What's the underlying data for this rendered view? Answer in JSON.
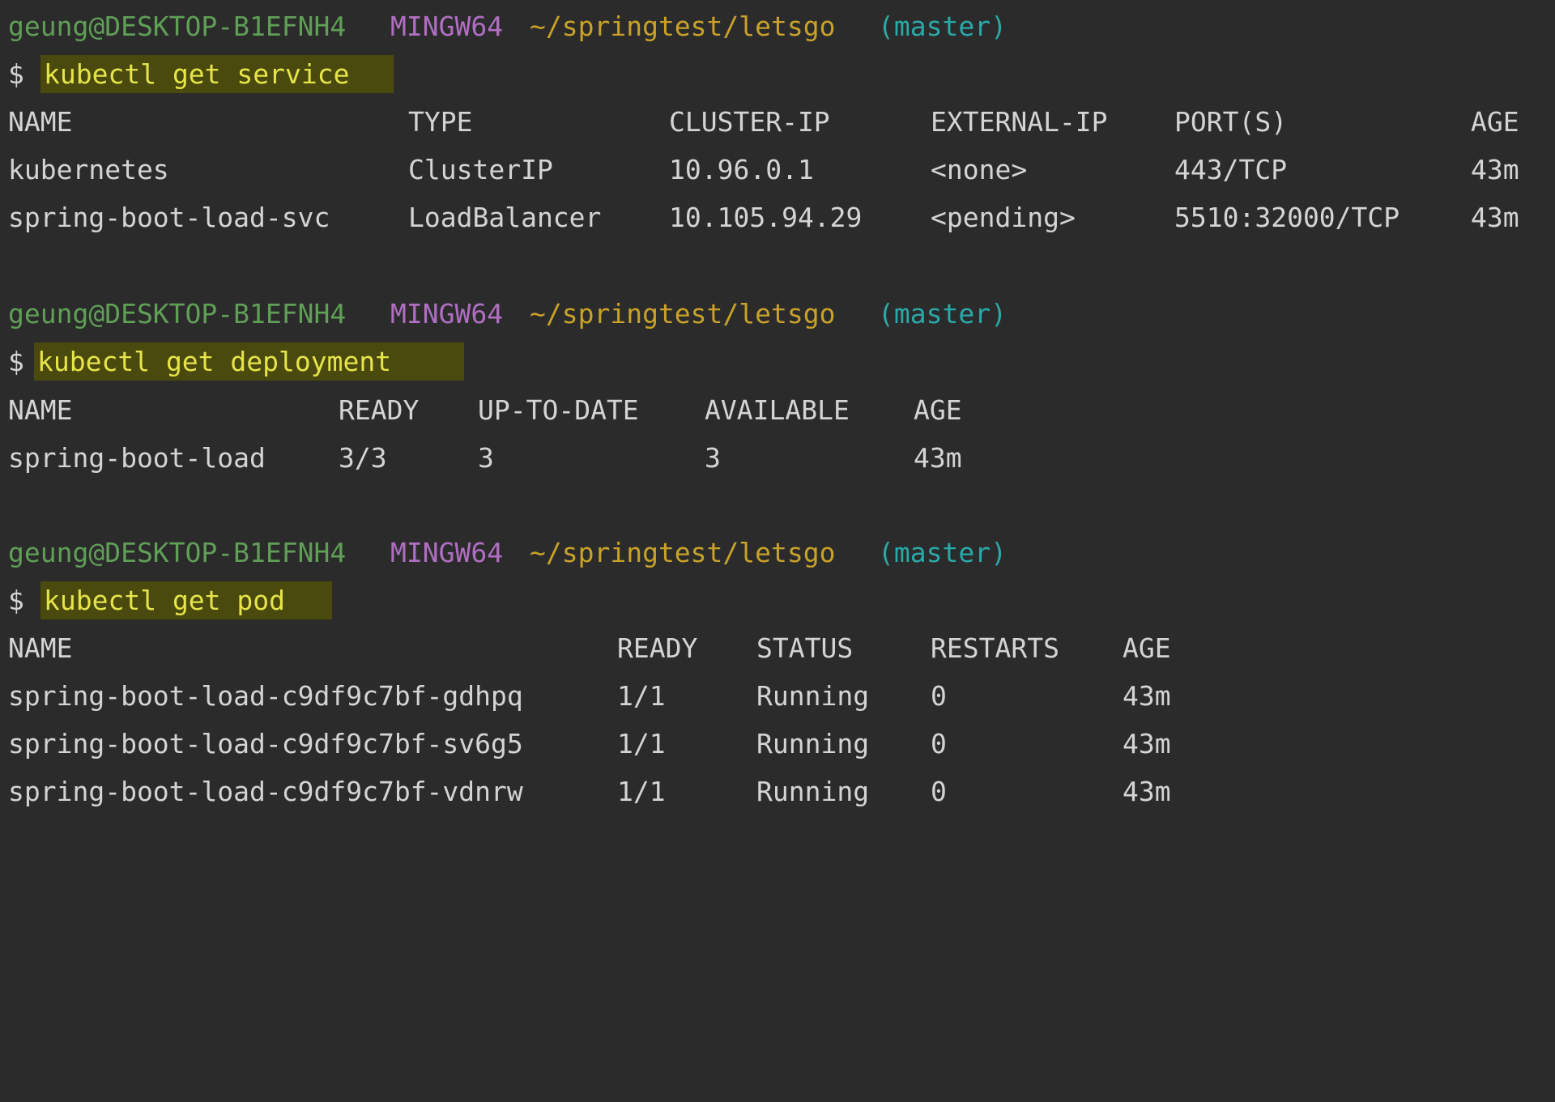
{
  "prompt": {
    "user_host": "geung@DESKTOP-B1EFNH4",
    "env": "MINGW64",
    "path": "~/springtest/letsgo",
    "branch": "(master)",
    "symbol": "$"
  },
  "colors": {
    "background": "#2b2b2b",
    "user": "#5f9f56",
    "env": "#b06fc2",
    "path": "#c9a227",
    "branch": "#2aa9a9",
    "highlight_bg": "#4a4a0e",
    "highlight_fg": "#e6e44a"
  },
  "blocks": [
    {
      "command": "kubectl get service",
      "headers": [
        "NAME",
        "TYPE",
        "CLUSTER-IP",
        "EXTERNAL-IP",
        "PORT(S)",
        "AGE"
      ],
      "rows": [
        [
          "kubernetes",
          "ClusterIP",
          "10.96.0.1",
          "<none>",
          "443/TCP",
          "43m"
        ],
        [
          "spring-boot-load-svc",
          "LoadBalancer",
          "10.105.94.29",
          "<pending>",
          "5510:32000/TCP",
          "43m"
        ]
      ]
    },
    {
      "command": "kubectl get deployment",
      "headers": [
        "NAME",
        "READY",
        "UP-TO-DATE",
        "AVAILABLE",
        "AGE"
      ],
      "rows": [
        [
          "spring-boot-load",
          "3/3",
          "3",
          "3",
          "43m"
        ]
      ]
    },
    {
      "command": "kubectl get pod",
      "headers": [
        "NAME",
        "READY",
        "STATUS",
        "RESTARTS",
        "AGE"
      ],
      "rows": [
        [
          "spring-boot-load-c9df9c7bf-gdhpq",
          "1/1",
          "Running",
          "0",
          "43m"
        ],
        [
          "spring-boot-load-c9df9c7bf-sv6g5",
          "1/1",
          "Running",
          "0",
          "43m"
        ],
        [
          "spring-boot-load-c9df9c7bf-vdnrw",
          "1/1",
          "Running",
          "0",
          "43m"
        ]
      ]
    }
  ]
}
